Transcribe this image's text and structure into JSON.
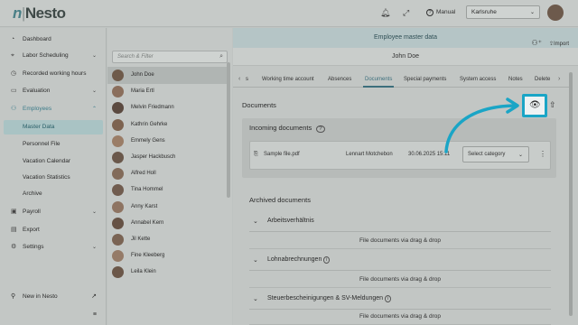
{
  "app": {
    "logo_mark": "n",
    "logo_text": "Nesto"
  },
  "topbar": {
    "manual_label": "Manual",
    "location": "Karlsruhe"
  },
  "sidebar": {
    "items": [
      {
        "label": "Dashboard",
        "icon": "dashboard-icon"
      },
      {
        "label": "Labor Scheduling",
        "icon": "scheduling-icon"
      },
      {
        "label": "Recorded working hours",
        "icon": "clock-icon"
      },
      {
        "label": "Evaluation",
        "icon": "evaluation-icon"
      },
      {
        "label": "Employees",
        "icon": "employees-icon"
      }
    ],
    "sub_items": [
      {
        "label": "Master Data"
      },
      {
        "label": "Personnel File"
      },
      {
        "label": "Vacation Calendar"
      },
      {
        "label": "Vacation Statistics"
      },
      {
        "label": "Archive"
      }
    ],
    "lower_items": [
      {
        "label": "Payroll",
        "icon": "payroll-icon"
      },
      {
        "label": "Export",
        "icon": "export-icon"
      },
      {
        "label": "Settings",
        "icon": "gear-icon"
      }
    ],
    "footer": {
      "new_in_nesto": "New in Nesto"
    }
  },
  "employee_list": {
    "search_placeholder": "Search & Filter",
    "employees": [
      "John Doe",
      "Maria Ertl",
      "Melvin Friedmann",
      "Kathrin Gehrke",
      "Emmely Gens",
      "Jasper Hackbusch",
      "Alfred Holl",
      "Tina Hommel",
      "Anny Karst",
      "Annabel Kern",
      "Jil Kette",
      "Fine Kleeberg",
      "Leila Klein"
    ],
    "selected": "John Doe"
  },
  "main": {
    "header_title": "Employee master data",
    "import_label": "Import",
    "employee_name": "John Doe",
    "tabs": [
      "s",
      "Working time account",
      "Absences",
      "Documents",
      "Special payments",
      "System access",
      "Notes",
      "Delete"
    ],
    "active_tab": "Documents",
    "documents_title": "Documents",
    "incoming_title": "Incoming documents",
    "incoming_doc": {
      "file_name": "Sample file.pdf",
      "uploaded_by": "Lennart Motchebon",
      "timestamp": "30.06.2025 15:11",
      "category_placeholder": "Select category"
    },
    "archived_title": "Archived documents",
    "archived_groups": [
      {
        "label": "Arbeitsverhältnis",
        "drop_text": "File documents via drag & drop"
      },
      {
        "label": "Lohnabrechnungen",
        "drop_text": "File documents via drag & drop"
      },
      {
        "label": "Steuerbescheinigungen & SV-Meldungen",
        "drop_text": "File documents via drag & drop"
      }
    ]
  },
  "colors": {
    "accent": "#3d7c8a",
    "highlight": "#1aa5c6"
  }
}
